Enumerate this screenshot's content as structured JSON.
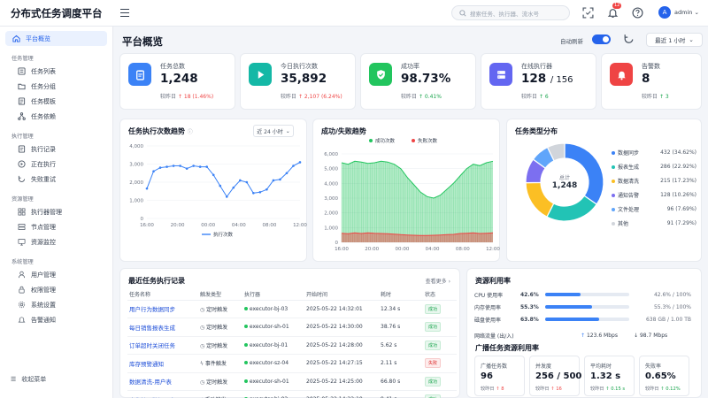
{
  "app": {
    "title": "分布式任务调度平台"
  },
  "header": {
    "search_placeholder": "搜索任务、执行器、流水号",
    "notifications": "12",
    "avatar_letter": "A",
    "user": "admin"
  },
  "sidebar": {
    "top": "平台概览",
    "groups": [
      {
        "label": "任务管理",
        "items": [
          "任务列表",
          "任务分组",
          "任务模板",
          "任务依赖"
        ]
      },
      {
        "label": "执行管理",
        "items": [
          "执行记录",
          "正在执行",
          "失败重试"
        ]
      },
      {
        "label": "资源管理",
        "items": [
          "执行器管理",
          "节点管理",
          "资源监控"
        ]
      },
      {
        "label": "系统管理",
        "items": [
          "用户管理",
          "权限管理",
          "系统设置",
          "告警通知"
        ]
      }
    ],
    "collapse": "收起菜单"
  },
  "page": {
    "title": "平台概览",
    "auto_refresh": "自动刷新",
    "time_range": "最近 1 小时"
  },
  "stats": [
    {
      "label": "任务总数",
      "value": "1,248",
      "sub_label": "较昨日",
      "delta": "18 (1.46%)",
      "trend": "up",
      "delta_color": "#ef4444",
      "color": "#3b82f6"
    },
    {
      "label": "今日执行次数",
      "value": "35,892",
      "sub_label": "较昨日",
      "delta": "2,107 (6.24%)",
      "trend": "up",
      "delta_color": "#ef4444",
      "color": "#14b8a6"
    },
    {
      "label": "成功率",
      "value": "98.73%",
      "sub_label": "较昨日",
      "delta": "0.41%",
      "trend": "up",
      "delta_color": "#16a34a",
      "color": "#22c55e"
    },
    {
      "label": "在线执行器",
      "value": "128",
      "value_total": "/ 156",
      "sub_label": "较昨日",
      "delta": "6",
      "trend": "up",
      "delta_color": "#16a34a",
      "color": "#6366f1"
    },
    {
      "label": "告警数",
      "value": "8",
      "sub_label": "较昨日",
      "delta": "3",
      "trend": "up",
      "delta_color": "#16a34a",
      "color": "#ef4444"
    }
  ],
  "trend_card": {
    "title": "任务执行次数趋势",
    "select": "近 24 小时"
  },
  "ratio_card": {
    "title": "成功/失败趋势"
  },
  "type_card": {
    "title": "任务类型分布",
    "center_label": "总计",
    "center_value": "1,248"
  },
  "recent": {
    "title": "最近任务执行记录",
    "more": "查看更多",
    "columns": [
      "任务名称",
      "触发类型",
      "执行器",
      "开始时间",
      "耗时",
      "状态"
    ],
    "rows": [
      {
        "name": "用户行为数据同步",
        "trigger": "定时触发",
        "trigger_icon": "clock-icon",
        "executor": "executor-bj-03",
        "start": "2025-05-22 14:32:01",
        "duration": "12.34 s",
        "status": "成功",
        "ok": true
      },
      {
        "name": "每日销售报表生成",
        "trigger": "定时触发",
        "trigger_icon": "clock-icon",
        "executor": "executor-sh-01",
        "start": "2025-05-22 14:30:00",
        "duration": "38.76 s",
        "status": "成功",
        "ok": true
      },
      {
        "name": "订单超时关闭任务",
        "trigger": "定时触发",
        "trigger_icon": "clock-icon",
        "executor": "executor-bj-01",
        "start": "2025-05-22 14:28:00",
        "duration": "5.62 s",
        "status": "成功",
        "ok": true
      },
      {
        "name": "库存预警通知",
        "trigger": "事件触发",
        "trigger_icon": "lightning-icon",
        "executor": "executor-sz-04",
        "start": "2025-05-22 14:27:15",
        "duration": "2.11 s",
        "status": "失败",
        "ok": false
      },
      {
        "name": "数据清洗-用户表",
        "trigger": "定时触发",
        "trigger_icon": "clock-icon",
        "executor": "executor-sh-01",
        "start": "2025-05-22 14:25:00",
        "duration": "66.80 s",
        "status": "成功",
        "ok": true
      },
      {
        "name": "广告效果数据同步",
        "trigger": "手动触发",
        "trigger_icon": "hand-icon",
        "executor": "executor-bj-02",
        "start": "2025-05-22 14:22:10",
        "duration": "9.41 s",
        "status": "成功",
        "ok": true
      }
    ]
  },
  "resources": {
    "title": "资源利用率",
    "rows": [
      {
        "label": "CPU 使用率",
        "pct": "42.6%",
        "pct_value": 42.6,
        "right": "42.6% / 100%"
      },
      {
        "label": "内存使用率",
        "pct": "55.3%",
        "pct_value": 55.3,
        "right": "55.3% / 100%"
      },
      {
        "label": "磁盘使用率",
        "pct": "63.8%",
        "pct_value": 63.8,
        "right": "638 GB / 1.00 TB"
      }
    ],
    "network_label": "网络流量 (出/入)",
    "net_out": "123.6 Mbps",
    "net_in": "98.7 Mbps",
    "sub_title": "广播任务资源利用率",
    "minis": [
      {
        "label": "广播任务数",
        "value": "96",
        "sub_label": "较昨日",
        "delta": "8",
        "delta_color": "#ef4444"
      },
      {
        "label": "并发度",
        "value": "256 / 500",
        "sub_label": "较昨日",
        "delta": "16",
        "delta_color": "#ef4444"
      },
      {
        "label": "平均耗时",
        "value": "1.32 s",
        "sub_label": "较昨日",
        "delta": "0.15 s",
        "delta_color": "#16a34a"
      },
      {
        "label": "失败率",
        "value": "0.65%",
        "sub_label": "较昨日",
        "delta": "0.12%",
        "delta_color": "#16a34a"
      }
    ]
  },
  "chart_data": [
    {
      "type": "line",
      "title": "任务执行次数趋势",
      "x": [
        "16:00",
        "17:00",
        "18:00",
        "19:00",
        "20:00",
        "21:00",
        "22:00",
        "23:00",
        "00:00",
        "01:00",
        "02:00",
        "03:00",
        "04:00",
        "05:00",
        "06:00",
        "07:00",
        "08:00",
        "09:00",
        "10:00",
        "11:00",
        "12:00",
        "13:00",
        "14:00"
      ],
      "x_tick_labels": [
        "16:00",
        "20:00",
        "00:00",
        "04:00",
        "08:00",
        "12:00"
      ],
      "series": [
        {
          "name": "执行次数",
          "color": "#3b82f6",
          "values": [
            1650,
            2600,
            2800,
            2850,
            2900,
            2900,
            2750,
            2900,
            2850,
            2850,
            2400,
            1800,
            1200,
            1700,
            2100,
            2000,
            1400,
            1450,
            1600,
            2100,
            2150,
            2500,
            2900,
            3100
          ]
        }
      ],
      "ylim": [
        0,
        4000
      ],
      "y_ticks": [
        "0",
        "1,000",
        "2,000",
        "3,000",
        "4,000"
      ],
      "grid": true,
      "legend": "bottom"
    },
    {
      "type": "area",
      "title": "成功/失败趋势",
      "x_tick_labels": [
        "16:00",
        "20:00",
        "00:00",
        "04:00",
        "08:00",
        "12:00"
      ],
      "series": [
        {
          "name": "成功次数",
          "color": "#22c55e",
          "values": [
            5400,
            5300,
            5500,
            5450,
            5350,
            5400,
            5500,
            5450,
            5300,
            5000,
            4400,
            3900,
            3400,
            3100,
            3000,
            3200,
            3600,
            4000,
            4500,
            5000,
            5300,
            5200,
            5400,
            5500
          ]
        },
        {
          "name": "失败次数",
          "color": "#ef4444",
          "values": [
            620,
            580,
            640,
            600,
            650,
            620,
            600,
            580,
            560,
            520,
            500,
            480,
            470,
            460,
            480,
            500,
            520,
            540,
            600,
            620,
            640,
            600,
            620,
            640
          ]
        }
      ],
      "ylim": [
        0,
        6000
      ],
      "y_ticks": [
        "0",
        "1,000",
        "2,000",
        "3,000",
        "4,000",
        "5,000",
        "6,000"
      ],
      "grid": true,
      "legend": "top"
    },
    {
      "type": "pie",
      "title": "任务类型分布",
      "slices": [
        {
          "label": "数据同步",
          "value": 432,
          "display": "432 (34.62%)",
          "color": "#3b82f6"
        },
        {
          "label": "报表生成",
          "value": 286,
          "display": "286 (22.92%)",
          "color": "#22c3b5"
        },
        {
          "label": "数据清洗",
          "value": 215,
          "display": "215 (17.23%)",
          "color": "#fbbf24"
        },
        {
          "label": "通知告警",
          "value": 128,
          "display": "128 (10.26%)",
          "color": "#7c6ff0"
        },
        {
          "label": "文件处理",
          "value": 96,
          "display": "96 (7.69%)",
          "color": "#60a5fa"
        },
        {
          "label": "其他",
          "value": 91,
          "display": "91 (7.29%)",
          "color": "#d1d5db"
        }
      ]
    }
  ]
}
